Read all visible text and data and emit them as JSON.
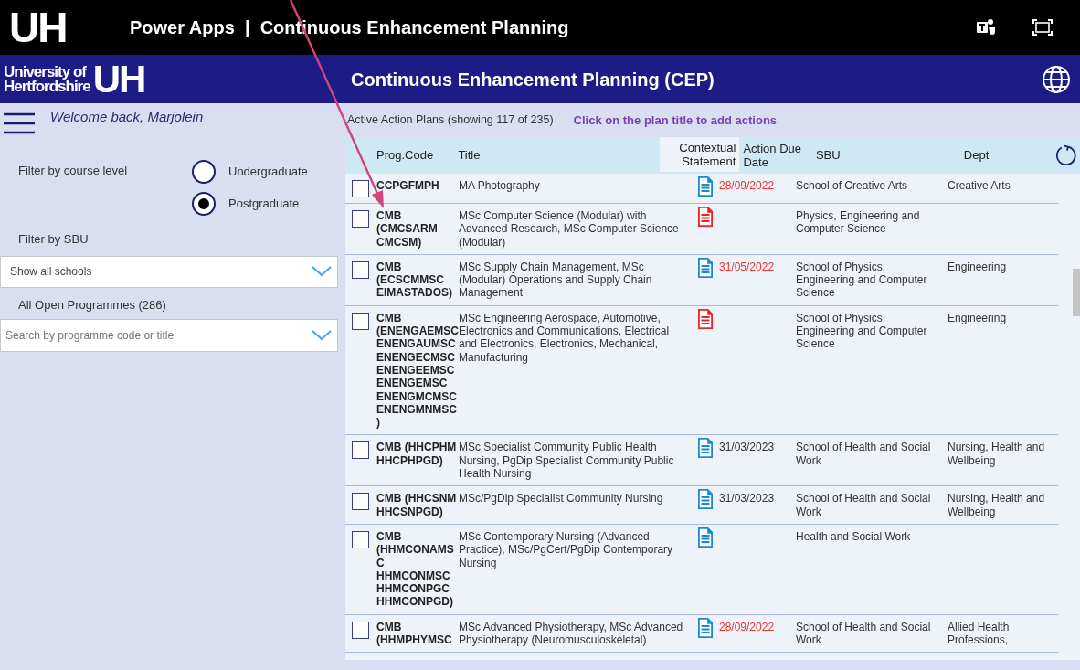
{
  "top_bar": {
    "logo": "UH",
    "title": "Power Apps  |  Continuous Enhancement Planning"
  },
  "header": {
    "logo_name": [
      "University of",
      "Hertfordshire"
    ],
    "logo_mark": "UH",
    "title": "Continuous Enhancement Planning (CEP)"
  },
  "sidebar": {
    "welcome": "Welcome back, Marjolein",
    "course_level_label": "Filter by course level",
    "course_levels": [
      {
        "label": "Undergraduate",
        "selected": false
      },
      {
        "label": "Postgraduate",
        "selected": true
      }
    ],
    "sbu_label": "Filter by SBU",
    "sbu_value": "Show all schools",
    "programmes_label": "All Open Programmes (286)",
    "search_placeholder": "Search by programme code or title"
  },
  "plans": {
    "summary": "Active Action Plans (showing 117 of 235)",
    "hint": "Click on the plan title to add actions",
    "columns": [
      "Prog.Code",
      "Title",
      "Contextual Statement",
      "Action Due Date",
      "SBU",
      "Dept"
    ],
    "rows": [
      {
        "checked": false,
        "code": [
          "CCPGFMPH"
        ],
        "title": "MA Photography",
        "statement": {
          "color": "#1b8ad0"
        },
        "due": "28/09/2022",
        "overdue": true,
        "sbu": "School of Creative Arts",
        "dept": "Creative Arts"
      },
      {
        "checked": false,
        "code": [
          "CMB",
          "(CMCSARM",
          "CMCSM)"
        ],
        "title": "MSc Computer Science (Modular) with Advanced Research, MSc Computer Science (Modular)",
        "statement": {
          "color": "#ee2222"
        },
        "sbu": "Physics, Engineering and Computer Science"
      },
      {
        "checked": false,
        "code": [
          "CMB",
          "(ECSCMMSC",
          "EIMASTADOS)"
        ],
        "title": "MSc Supply Chain Management, MSc (Modular) Operations and Supply Chain Management",
        "statement": {
          "color": "#1b8ad0"
        },
        "due": "31/05/2022",
        "overdue": true,
        "sbu": "School of Physics, Engineering and Computer Science",
        "dept": "Engineering"
      },
      {
        "checked": false,
        "code": [
          "CMB",
          "(ENENGAEMSC",
          "ENENGAUMSC",
          "ENENGECMSC",
          "ENENGEEMSC",
          "ENENGEMSC",
          "ENENGMCMSC",
          "ENENGMNMSC",
          ")"
        ],
        "title": "MSc Engineering Aerospace, Automotive, Electronics and Communications, Electrical and Electronics, Electronics, Mechanical, Manufacturing",
        "statement": {
          "color": "#ee2222"
        },
        "sbu": "School of Physics, Engineering and Computer Science",
        "dept": "Engineering"
      },
      {
        "checked": false,
        "code": [
          "CMB (HHCPHM",
          "HHCPHPGD)"
        ],
        "title": "MSc Specialist Community Public Health Nursing, PgDip Specialist Community Public Health Nursing",
        "statement": {
          "color": "#1b8ad0"
        },
        "due": "31/03/2023",
        "overdue": false,
        "sbu": "School of Health and Social Work",
        "dept": "Nursing, Health and Wellbeing"
      },
      {
        "checked": false,
        "code": [
          "CMB (HHCSNM",
          "HHCSNPGD)"
        ],
        "title": "MSc/PgDip Specialist Community Nursing",
        "statement": {
          "color": "#1b8ad0"
        },
        "due": "31/03/2023",
        "overdue": false,
        "sbu": "School of Health and Social Work",
        "dept": "Nursing, Health and Wellbeing"
      },
      {
        "checked": false,
        "code": [
          "CMB",
          "(HHMCONAMS",
          "C",
          "HHMCONMSC",
          "HHMCONPGC",
          "HHMCONPGD)"
        ],
        "title": "MSc Contemporary Nursing (Advanced Practice), MSc/PgCert/PgDip Contemporary Nursing",
        "statement": {
          "color": "#1b8ad0"
        },
        "sbu": "Health and Social Work"
      },
      {
        "checked": false,
        "code": [
          "CMB",
          "(HHMPHYMSC"
        ],
        "title": "MSc Advanced Physiotherapy, MSc Advanced Physiotherapy (Neuromusculoskeletal)",
        "statement": {
          "color": "#1b8ad0"
        },
        "due": "28/09/2022",
        "overdue": true,
        "sbu": "School of Health and Social Work",
        "dept": "Allied Health Professions,"
      }
    ]
  }
}
